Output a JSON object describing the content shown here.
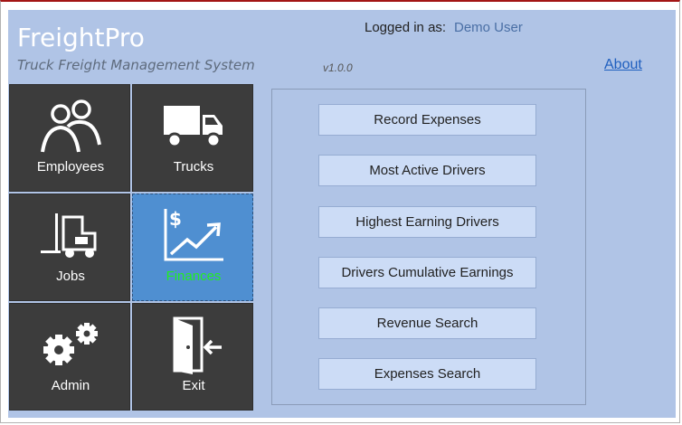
{
  "app": {
    "title": "FreightPro",
    "subtitle": "Truck Freight Management System",
    "version": "v1.0.0"
  },
  "session": {
    "logged_label": "Logged in as:",
    "user": "Demo User"
  },
  "links": {
    "about": "About"
  },
  "tiles": [
    {
      "label": "Employees",
      "icon": "users-icon"
    },
    {
      "label": "Trucks",
      "icon": "truck-icon"
    },
    {
      "label": "Jobs",
      "icon": "forklift-icon"
    },
    {
      "label": "Finances",
      "icon": "finance-chart-icon",
      "active": true
    },
    {
      "label": "Admin",
      "icon": "gears-icon"
    },
    {
      "label": "Exit",
      "icon": "exit-door-icon"
    }
  ],
  "finance_menu": [
    "Record Expenses",
    "Most Active Drivers",
    "Highest Earning Drivers",
    "Drivers Cumulative Earnings",
    "Revenue Search",
    "Expenses Search"
  ],
  "colors": {
    "panel": "#b0c4e6",
    "tile": "#3c3c3c",
    "tile_active": "#4f8fd1",
    "active_label": "#22ee22",
    "menu_button": "#ccdcf6"
  }
}
